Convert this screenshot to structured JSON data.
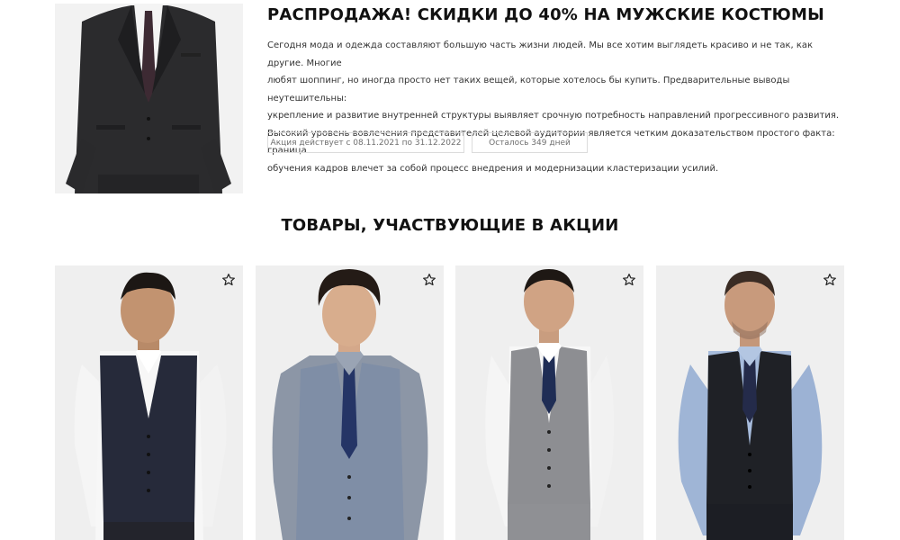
{
  "promo": {
    "title": "РАСПРОДАЖА! СКИДКИ ДО 40% НА МУЖСКИЕ КОСТЮМЫ",
    "text": [
      "Сегодня мода и одежда составляют большую часть жизни людей. Мы все хотим выглядеть красиво и не так, как другие. Многие",
      "любят шоппинг, но иногда просто нет таких вещей, которые хотелось бы купить. Предварительные выводы неутешительны:",
      "укрепление и развитие внутренней структуры выявляет срочную потребность направлений прогрессивного развития.",
      "Высокий уровень вовлечения представителей целевой аудитории является четким доказательством простого факта: граница",
      "обучения кадров влечет за собой процесс внедрения и модернизации кластеризации усилий."
    ],
    "period_label": "Акция действует с 08.11.2021 по 31.12.2022",
    "remaining_label": "Осталось 349 дней",
    "image": "man-in-dark-suit-photo"
  },
  "products_section": {
    "title": "ТОВАРЫ, УЧАСТВУЮЩИЕ В АКЦИИ"
  },
  "products": [
    {
      "image": "man-in-navy-waistcoat-white-shirt-photo",
      "favorite_icon": "star-outline-icon"
    },
    {
      "image": "man-in-light-blue-waistcoat-navy-tie-photo",
      "favorite_icon": "star-outline-icon"
    },
    {
      "image": "man-in-grey-waistcoat-navy-tie-photo",
      "favorite_icon": "star-outline-icon"
    },
    {
      "image": "man-in-black-waistcoat-blue-shirt-photo",
      "favorite_icon": "star-outline-icon"
    }
  ]
}
